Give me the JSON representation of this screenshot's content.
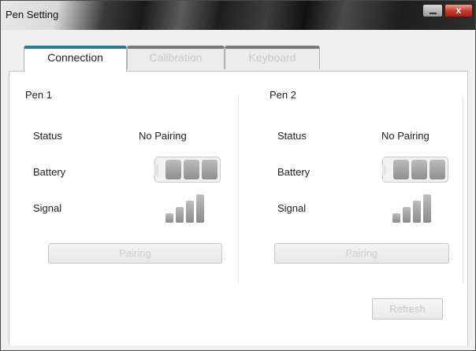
{
  "window": {
    "title": "Pen Setting",
    "close_label": "x"
  },
  "tabs": [
    {
      "label": "Connection"
    },
    {
      "label": "Calibration"
    },
    {
      "label": "Keyboard"
    }
  ],
  "pens": [
    {
      "title": "Pen 1",
      "status_label": "Status",
      "status_value": "No Pairing",
      "battery_label": "Battery",
      "battery_icon": "battery-icon",
      "signal_label": "Signal",
      "signal_icon": "signal-bars-icon",
      "pair_label": "Pairing"
    },
    {
      "title": "Pen 2",
      "status_label": "Status",
      "status_value": "No Pairing",
      "battery_label": "Battery",
      "battery_icon": "battery-icon",
      "signal_label": "Signal",
      "signal_icon": "signal-bars-icon",
      "pair_label": "Pairing"
    }
  ],
  "refresh_label": "Refresh"
}
